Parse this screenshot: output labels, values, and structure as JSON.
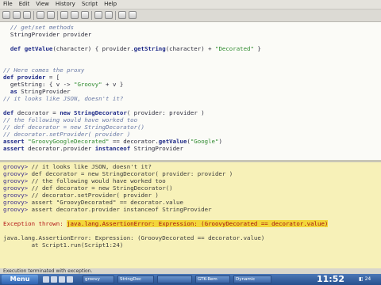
{
  "menu": [
    "File",
    "Edit",
    "View",
    "History",
    "Script",
    "Help"
  ],
  "toolbar": {
    "buttons": [
      "new-icon",
      "open-icon",
      "save-icon",
      "undo-icon",
      "redo-icon",
      "cut-icon",
      "copy-icon",
      "paste-icon",
      "history-prev-icon",
      "history-next-icon",
      "run-icon",
      "clear-icon"
    ]
  },
  "editor": {
    "lines": [
      [
        {
          "t": "  // get/set methods",
          "c": "cm"
        }
      ],
      [
        {
          "t": "  StringProvider provider",
          "c": "tx"
        }
      ],
      [
        {
          "t": "",
          "c": "tx"
        }
      ],
      [
        {
          "t": "  def ",
          "c": "kw"
        },
        {
          "t": "getValue",
          "c": "kw"
        },
        {
          "t": "(character) { provider.",
          "c": "tx"
        },
        {
          "t": "getString",
          "c": "kw"
        },
        {
          "t": "(character) + ",
          "c": "tx"
        },
        {
          "t": "\"Decorated\"",
          "c": "st"
        },
        {
          "t": " }",
          "c": "tx"
        }
      ],
      [
        {
          "t": "",
          "c": "tx"
        }
      ],
      [
        {
          "t": "",
          "c": "tx"
        }
      ],
      [
        {
          "t": "// Here comes the proxy",
          "c": "cm"
        }
      ],
      [
        {
          "t": "def provider",
          "c": "kw"
        },
        {
          "t": " = [",
          "c": "tx"
        }
      ],
      [
        {
          "t": "  getString: { v -> ",
          "c": "tx"
        },
        {
          "t": "\"Groovy\"",
          "c": "st"
        },
        {
          "t": " + v }",
          "c": "tx"
        }
      ],
      [
        {
          "t": "  ",
          "c": "tx"
        },
        {
          "t": "as",
          "c": "kw"
        },
        {
          "t": " StringProvider",
          "c": "tx"
        }
      ],
      [
        {
          "t": "// it looks like JSON, doesn't it?",
          "c": "cm"
        }
      ],
      [
        {
          "t": "",
          "c": "tx"
        }
      ],
      [
        {
          "t": "def",
          "c": "kw"
        },
        {
          "t": " decorator = ",
          "c": "tx"
        },
        {
          "t": "new",
          "c": "kw"
        },
        {
          "t": " StringDecorator",
          "c": "kw"
        },
        {
          "t": "( provider: provider )",
          "c": "tx"
        }
      ],
      [
        {
          "t": "// the following would have worked too",
          "c": "cm"
        }
      ],
      [
        {
          "t": "// def decorator = new StringDecorator()",
          "c": "cm"
        }
      ],
      [
        {
          "t": "// decorator.setProvider( provider )",
          "c": "cm"
        }
      ],
      [
        {
          "t": "assert",
          "c": "kw"
        },
        {
          "t": " ",
          "c": "tx"
        },
        {
          "t": "\"GroovyGoogleDecorated\"",
          "c": "st"
        },
        {
          "t": " == decorator.",
          "c": "tx"
        },
        {
          "t": "getValue",
          "c": "kw"
        },
        {
          "t": "(",
          "c": "tx"
        },
        {
          "t": "\"Google\"",
          "c": "st"
        },
        {
          "t": ")",
          "c": "tx"
        }
      ],
      [
        {
          "t": "assert",
          "c": "kw"
        },
        {
          "t": " decorator.provider ",
          "c": "tx"
        },
        {
          "t": "instanceof",
          "c": "kw"
        },
        {
          "t": " StringProvider",
          "c": "tx"
        }
      ]
    ]
  },
  "output": {
    "lines": [
      [
        {
          "t": "groovy> ",
          "c": "pr"
        },
        {
          "t": "// it looks like JSON, doesn't it?",
          "c": "ot"
        }
      ],
      [
        {
          "t": "groovy> ",
          "c": "pr"
        },
        {
          "t": "def decorator = new StringDecorator( provider: provider )",
          "c": "ot"
        }
      ],
      [
        {
          "t": "groovy> ",
          "c": "pr"
        },
        {
          "t": "// the following would have worked too",
          "c": "ot"
        }
      ],
      [
        {
          "t": "groovy> ",
          "c": "pr"
        },
        {
          "t": "// def decorator = new StringDecorator()",
          "c": "ot"
        }
      ],
      [
        {
          "t": "groovy> ",
          "c": "pr"
        },
        {
          "t": "// decorator.setProvider( provider )",
          "c": "ot"
        }
      ],
      [
        {
          "t": "groovy> ",
          "c": "pr"
        },
        {
          "t": "assert \"GroovyDecorated\" == decorator.value",
          "c": "ot"
        }
      ],
      [
        {
          "t": "groovy> ",
          "c": "pr"
        },
        {
          "t": "assert decorator.provider instanceof StringProvider",
          "c": "ot"
        }
      ],
      [
        {
          "t": "",
          "c": "ot"
        }
      ],
      [
        {
          "t": "Exception thrown: ",
          "c": "err"
        },
        {
          "t": "java.lang.AssertionError: Expression: (GroovyDecorated == decorator.value)",
          "c": "errhl"
        }
      ],
      [
        {
          "t": "",
          "c": "ot"
        }
      ],
      [
        {
          "t": "java.lang.AssertionError: Expression: (GroovyDecorated == decorator.value)",
          "c": "ot"
        }
      ],
      [
        {
          "t": "        at Script1.run(Script1:24)",
          "c": "ot"
        }
      ]
    ]
  },
  "status": {
    "text": "Execution terminated with exception."
  },
  "taskbar": {
    "start_label": "Menu",
    "tasks": [
      "groovy",
      "StringDec",
      "",
      "GTK-Rem",
      "Dynamic"
    ],
    "clock": "11:52",
    "tray": "24"
  }
}
